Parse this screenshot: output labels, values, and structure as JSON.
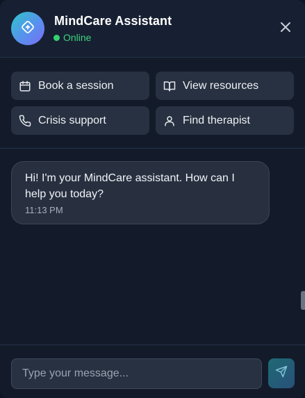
{
  "header": {
    "title": "MindCare Assistant",
    "status": "Online",
    "avatar_icon": "brain-chat-icon",
    "close_icon": "close-icon"
  },
  "quick_actions": [
    {
      "label": "Book a session",
      "icon": "calendar-icon"
    },
    {
      "label": "View resources",
      "icon": "book-open-icon"
    },
    {
      "label": "Crisis support",
      "icon": "phone-icon"
    },
    {
      "label": "Find therapist",
      "icon": "user-icon"
    }
  ],
  "messages": [
    {
      "sender": "assistant",
      "text": "Hi! I'm your MindCare assistant. How can I help you today?",
      "time": "11:13 PM"
    }
  ],
  "composer": {
    "placeholder": "Type your message...",
    "value": "",
    "send_icon": "send-icon"
  },
  "colors": {
    "background": "#131b2b",
    "surface": "#283141",
    "online": "#34d16f",
    "accent_start": "#2ec4c9",
    "accent_end": "#7a6cf2"
  }
}
